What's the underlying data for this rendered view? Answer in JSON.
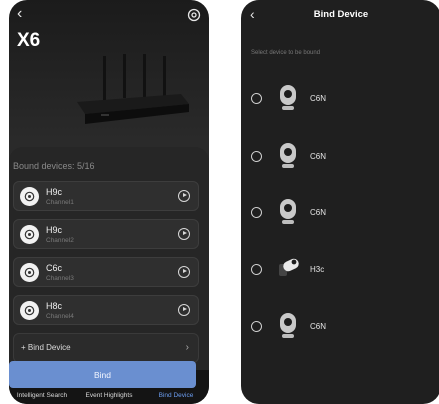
{
  "left": {
    "title": "X6",
    "bound_label": "Bound devices: 5/16",
    "devices": [
      {
        "name": "H9c",
        "channel": "Channel1"
      },
      {
        "name": "H9c",
        "channel": "Channel2"
      },
      {
        "name": "C6c",
        "channel": "Channel3"
      },
      {
        "name": "H8c",
        "channel": "Channel4"
      }
    ],
    "bind_device_label": "+ Bind Device",
    "tabs": [
      {
        "label": "Intelligent Search",
        "icon": "logo-icon"
      },
      {
        "label": "Event Highlights",
        "icon": "circle-dots-icon"
      },
      {
        "label": "Bind Device",
        "icon": "link-icon",
        "active": true
      }
    ],
    "colors": {
      "accent": "#6b9df0"
    }
  },
  "right": {
    "title": "Bind Device",
    "subtitle": "Select device to be bound",
    "devices": [
      {
        "name": "C6N",
        "icon": "dome-camera-icon"
      },
      {
        "name": "C6N",
        "icon": "dome-camera-icon"
      },
      {
        "name": "C6N",
        "icon": "dome-camera-icon"
      },
      {
        "name": "H3c",
        "icon": "bullet-camera-icon"
      },
      {
        "name": "C6N",
        "icon": "dome-camera-icon"
      }
    ],
    "bind_button": "Bind",
    "colors": {
      "button": "#6a8fd0"
    }
  }
}
